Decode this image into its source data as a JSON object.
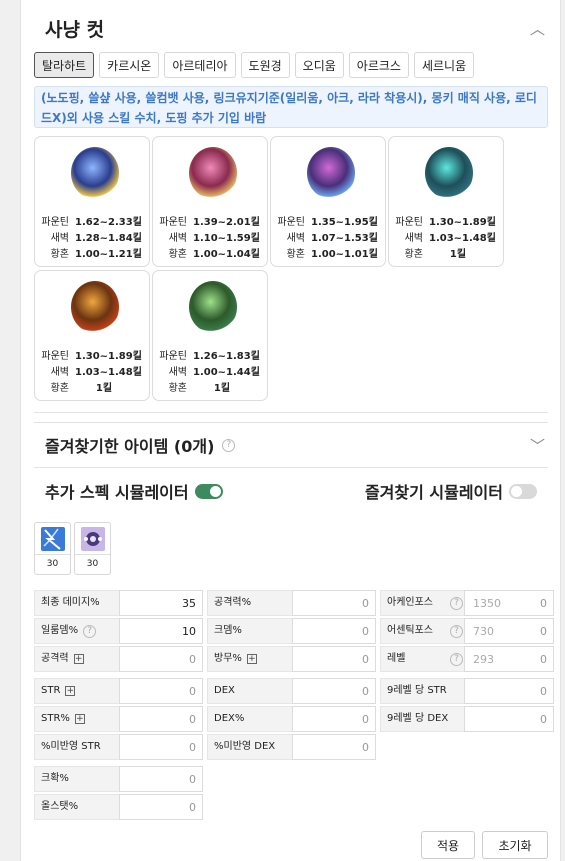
{
  "section": {
    "title": "사냥 컷"
  },
  "tabs": [
    "탈라하트",
    "카르시온",
    "아르테리아",
    "도원경",
    "오디움",
    "아르크스",
    "세르니움"
  ],
  "notice": "(노도핑, 쓸샾 사용, 쓸컴뱃 사용, 링크유지기준(일리움, 아크, 라라 착용시), 몽키 매직 사용, 로디드X)외 사용 스킬 수치, 도핑 추가 기입 바람",
  "boss_cards": [
    {
      "colors": [
        "#2a3d8f",
        "#8fb6ff",
        "#e8c14a"
      ],
      "rows": [
        [
          "파운틴",
          "1.62~2.33킬"
        ],
        [
          "새벽",
          "1.28~1.84킬"
        ],
        [
          "황혼",
          "1.00~1.21킬"
        ]
      ]
    },
    {
      "colors": [
        "#8a2a4f",
        "#f08ab8",
        "#e4b063"
      ],
      "rows": [
        [
          "파운틴",
          "1.39~2.01킬"
        ],
        [
          "새벽",
          "1.10~1.59킬"
        ],
        [
          "황혼",
          "1.00~1.04킬"
        ]
      ]
    },
    {
      "colors": [
        "#4a2f7a",
        "#d06ad7",
        "#6aa0e8"
      ],
      "rows": [
        [
          "파운틴",
          "1.35~1.95킬"
        ],
        [
          "새벽",
          "1.07~1.53킬"
        ],
        [
          "황혼",
          "1.00~1.01킬"
        ]
      ]
    },
    {
      "colors": [
        "#1e4f5a",
        "#5de8e0",
        "#2f6f7a"
      ],
      "rows": [
        [
          "파운틴",
          "1.30~1.89킬"
        ],
        [
          "새벽",
          "1.03~1.48킬"
        ],
        [
          "황혼",
          "1킬"
        ]
      ]
    },
    {
      "colors": [
        "#6b3410",
        "#f0a640",
        "#c0401a"
      ],
      "rows": [
        [
          "파운틴",
          "1.30~1.89킬"
        ],
        [
          "새벽",
          "1.03~1.48킬"
        ],
        [
          "황혼",
          "1킬"
        ]
      ]
    },
    {
      "colors": [
        "#2d5a2a",
        "#9ee08a",
        "#3a7a4a"
      ],
      "rows": [
        [
          "파운틴",
          "1.26~1.83킬"
        ],
        [
          "새벽",
          "1.00~1.44킬"
        ],
        [
          "황혼",
          "1킬"
        ]
      ]
    }
  ],
  "favorites": {
    "title": "즐겨찾기한 아이템 (0개)"
  },
  "simulators": {
    "spec": "추가 스펙 시뮬레이터",
    "spec_on": true,
    "fav": "즐겨찾기 시뮬레이터",
    "fav_on": false
  },
  "skills": [
    {
      "value": "30"
    },
    {
      "value": "30"
    }
  ],
  "stats_col1": [
    {
      "label": "최종 데미지%",
      "value": "35",
      "plus": false,
      "help": false
    },
    {
      "label": "일룸뎀%",
      "value": "10",
      "plus": false,
      "help": true
    },
    {
      "label": "공격력",
      "value": "0",
      "plus": true,
      "help": false
    },
    {
      "label": "STR",
      "value": "0",
      "plus": true,
      "help": false
    },
    {
      "label": "STR%",
      "value": "0",
      "plus": true,
      "help": false
    },
    {
      "label": "%미반영 STR",
      "value": "0",
      "plus": false,
      "help": false
    },
    {
      "label": "크확%",
      "value": "0",
      "plus": false,
      "help": false
    },
    {
      "label": "올스탯%",
      "value": "0",
      "plus": false,
      "help": false
    }
  ],
  "stats_col2": [
    {
      "label": "공격력%",
      "value": "0",
      "plus": false
    },
    {
      "label": "크뎀%",
      "value": "0",
      "plus": false
    },
    {
      "label": "방무%",
      "value": "0",
      "plus": true
    },
    {
      "label": "DEX",
      "value": "0",
      "plus": false
    },
    {
      "label": "DEX%",
      "value": "0",
      "plus": false
    },
    {
      "label": "%미반영 DEX",
      "value": "0",
      "plus": false
    }
  ],
  "stats_col3": [
    {
      "label": "아케인포스",
      "hint": "1350",
      "value": "0",
      "help": true
    },
    {
      "label": "어센틱포스",
      "hint": "730",
      "value": "0",
      "help": true
    },
    {
      "label": "레벨",
      "hint": "293",
      "value": "0",
      "help": true
    },
    {
      "label": "9레벨 당 STR",
      "hint": "",
      "value": "0",
      "help": false
    },
    {
      "label": "9레벨 당 DEX",
      "hint": "",
      "value": "0",
      "help": false
    }
  ],
  "buttons": {
    "apply": "적용",
    "reset": "초기화"
  }
}
